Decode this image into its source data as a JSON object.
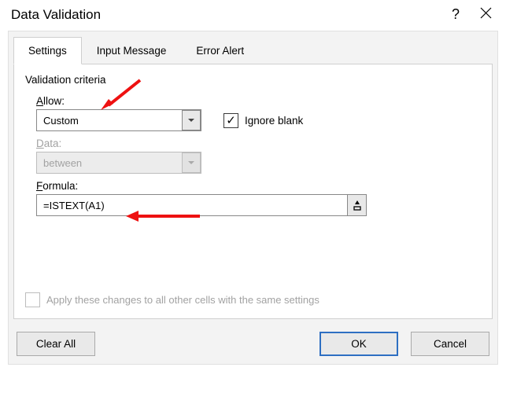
{
  "title": "Data Validation",
  "tabs": [
    {
      "label": "Settings",
      "active": true
    },
    {
      "label": "Input Message",
      "active": false
    },
    {
      "label": "Error Alert",
      "active": false
    }
  ],
  "criteria": {
    "section_title": "Validation criteria",
    "allow_label_pre": "A",
    "allow_label_post": "llow:",
    "allow_value": "Custom",
    "ignore_blank_label_pre": "Ignore ",
    "ignore_blank_label_post": "lank",
    "ignore_blank_ul": "b",
    "ignore_blank_checked": true,
    "data_label_pre": "",
    "data_label_ul": "D",
    "data_label_post": "ata:",
    "data_value": "between",
    "formula_label_pre": "",
    "formula_label_ul": "F",
    "formula_label_post": "ormula:",
    "formula_value": "=ISTEXT(A1)",
    "apply_all_label_pre": "A",
    "apply_all_label_ul": "p",
    "apply_all_label_post": "ply these changes to all other cells with the same settings",
    "apply_all_checked": false
  },
  "buttons": {
    "clear_all_pre": "",
    "clear_all_ul": "C",
    "clear_all_post": "lear All",
    "ok": "OK",
    "cancel": "Cancel"
  }
}
